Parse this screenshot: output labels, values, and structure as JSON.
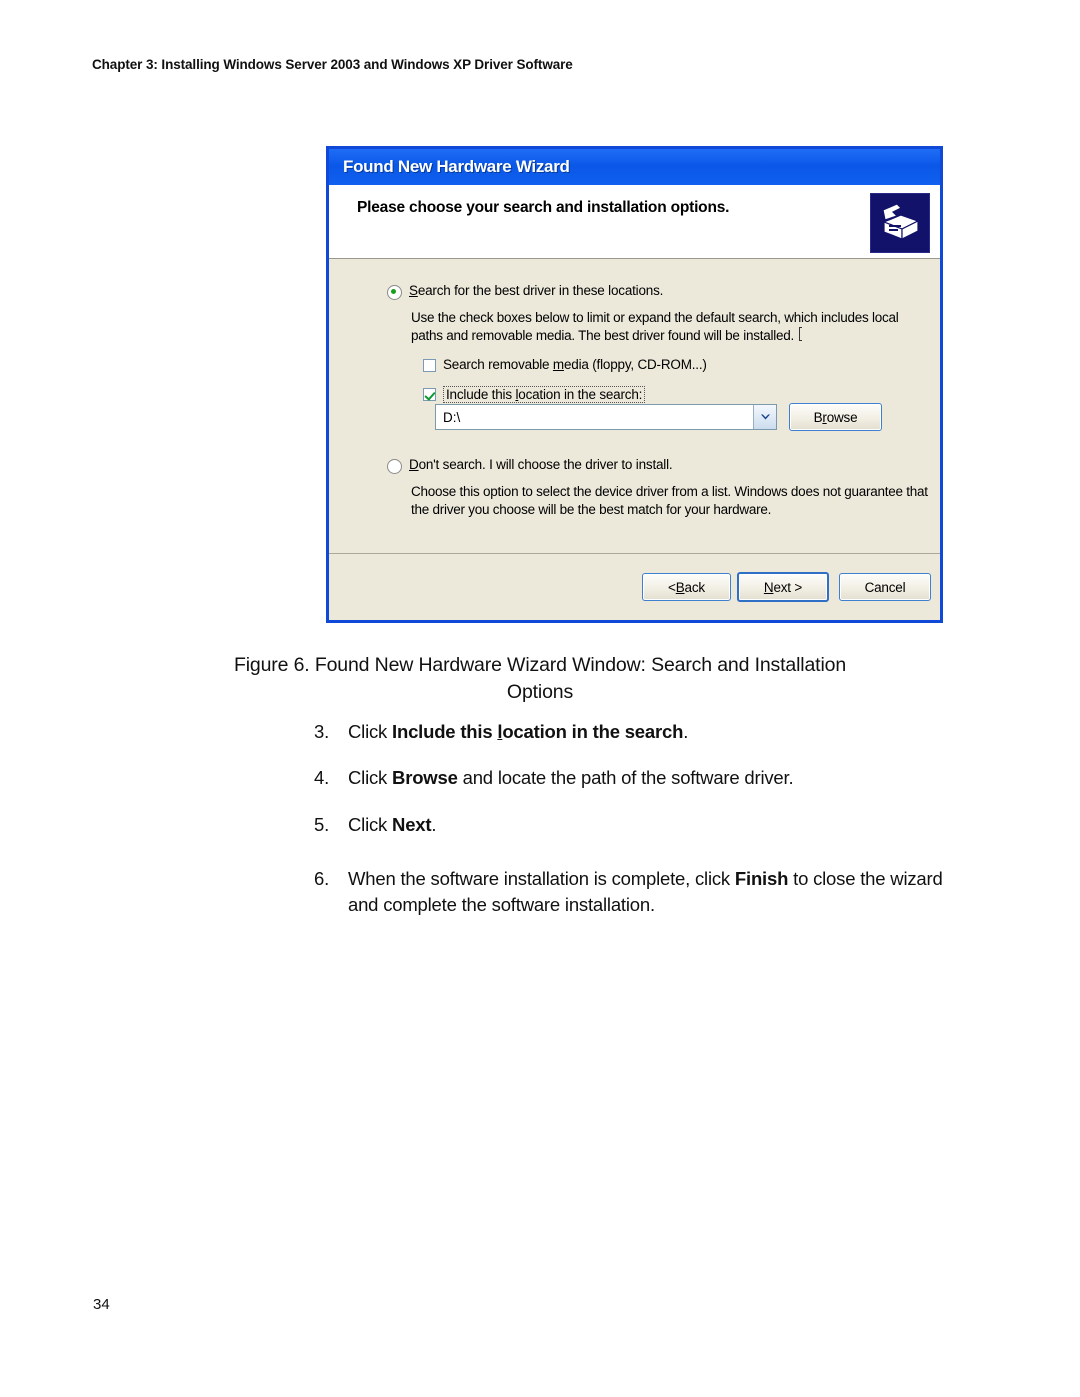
{
  "page": {
    "running_head": "Chapter 3: Installing Windows Server 2003 and Windows XP Driver Software",
    "page_number": "34"
  },
  "dialog": {
    "title": "Found New Hardware Wizard",
    "header_title": "Please choose your search and installation options.",
    "header_icon": "hardware-wizard-icon",
    "options": {
      "search_best_driver": {
        "label_pre": "",
        "label_accel": "S",
        "label_post": "earch for the best driver in these locations.",
        "selected": true,
        "description": "Use the check boxes below to limit or expand the default search, which includes local paths and removable media. The best driver found will be installed."
      },
      "search_removable": {
        "label_pre": "Search removable ",
        "label_accel": "m",
        "label_post": "edia (floppy, CD-ROM...)",
        "checked": false
      },
      "include_location": {
        "label_pre": "Include this ",
        "label_accel": "l",
        "label_post": "ocation in the search:",
        "checked": true,
        "focused": true
      },
      "dont_search": {
        "label_pre": "",
        "label_accel": "D",
        "label_post": "on't search. I will choose the driver to install.",
        "selected": false,
        "description": "Choose this option to select the device driver from a list.  Windows does not guarantee that the driver you choose will be the best match for your hardware."
      }
    },
    "location_combo": {
      "value": "D:\\",
      "arrow_icon": "chevron-down-icon"
    },
    "browse_button": {
      "label_pre": "B",
      "label_accel": "r",
      "label_post": "owse"
    },
    "buttons": {
      "back": {
        "label_pre": "< ",
        "label_accel": "B",
        "label_post": "ack"
      },
      "next": {
        "label_pre": "",
        "label_accel": "N",
        "label_post": "ext >",
        "is_default": true
      },
      "cancel": {
        "label": "Cancel"
      }
    },
    "colors": {
      "titlebar_blue": "#0a57e8",
      "dialog_border": "#1049d8",
      "body_beige": "#ece9db",
      "radio_green": "#18a018",
      "check_green": "#0c9a30",
      "icon_navy": "#12126b"
    }
  },
  "figure": {
    "caption_line1": "Figure 6. Found New Hardware Wizard Window: Search and Installation",
    "caption_line2": "Options"
  },
  "steps": [
    {
      "number": "3.",
      "pre": "Click ",
      "bold_pre": "Include this ",
      "bold_accel": "l",
      "bold_post": "ocation in the search",
      "post": "."
    },
    {
      "number": "4.",
      "pre": "Click ",
      "bold": "Browse",
      "post": " and locate the path of the software driver."
    },
    {
      "number": "5.",
      "pre": "Click ",
      "bold": "Next",
      "post": "."
    },
    {
      "number": "6.",
      "pre": "When the software installation is complete, click ",
      "bold": "Finish",
      "post": " to close the wizard and complete the software installation."
    }
  ]
}
